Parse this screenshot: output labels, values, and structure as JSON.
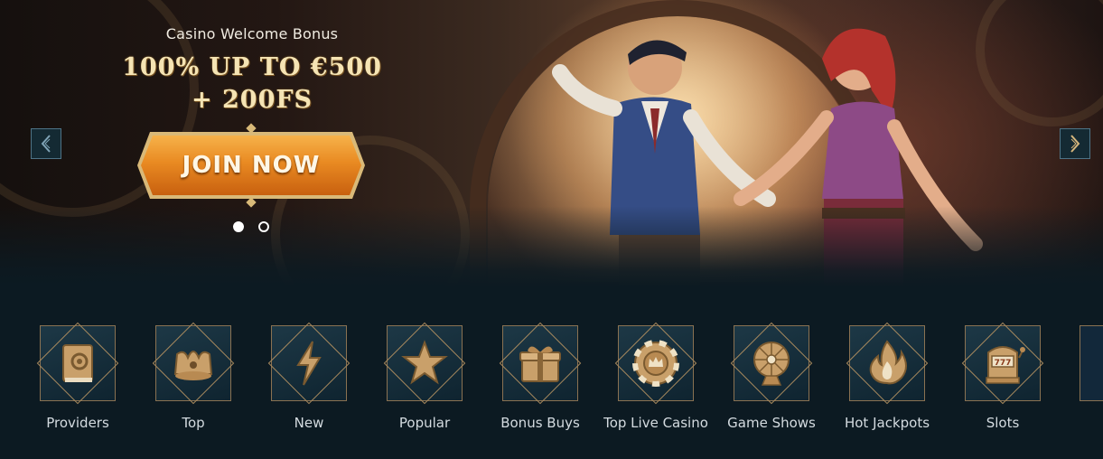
{
  "hero": {
    "subtitle": "Casino Welcome Bonus",
    "title": "100% UP TO €500 + 200FS",
    "cta_label": "JOIN NOW",
    "slides": 2,
    "active_slide": 1
  },
  "categories": [
    {
      "label": "Providers",
      "icon": "book-gear-icon"
    },
    {
      "label": "Top",
      "icon": "crown-icon"
    },
    {
      "label": "New",
      "icon": "lightning-icon"
    },
    {
      "label": "Popular",
      "icon": "star-icon"
    },
    {
      "label": "Bonus Buys",
      "icon": "gift-box-icon"
    },
    {
      "label": "Top Live Casino",
      "icon": "casino-chip-icon"
    },
    {
      "label": "Game Shows",
      "icon": "prize-wheel-icon"
    },
    {
      "label": "Hot Jackpots",
      "icon": "flame-icon"
    },
    {
      "label": "Slots",
      "icon": "slot-machine-icon"
    }
  ],
  "colors": {
    "gold": "#d9b978",
    "cta_orange": "#e98a22",
    "background": "#0c1a22"
  }
}
